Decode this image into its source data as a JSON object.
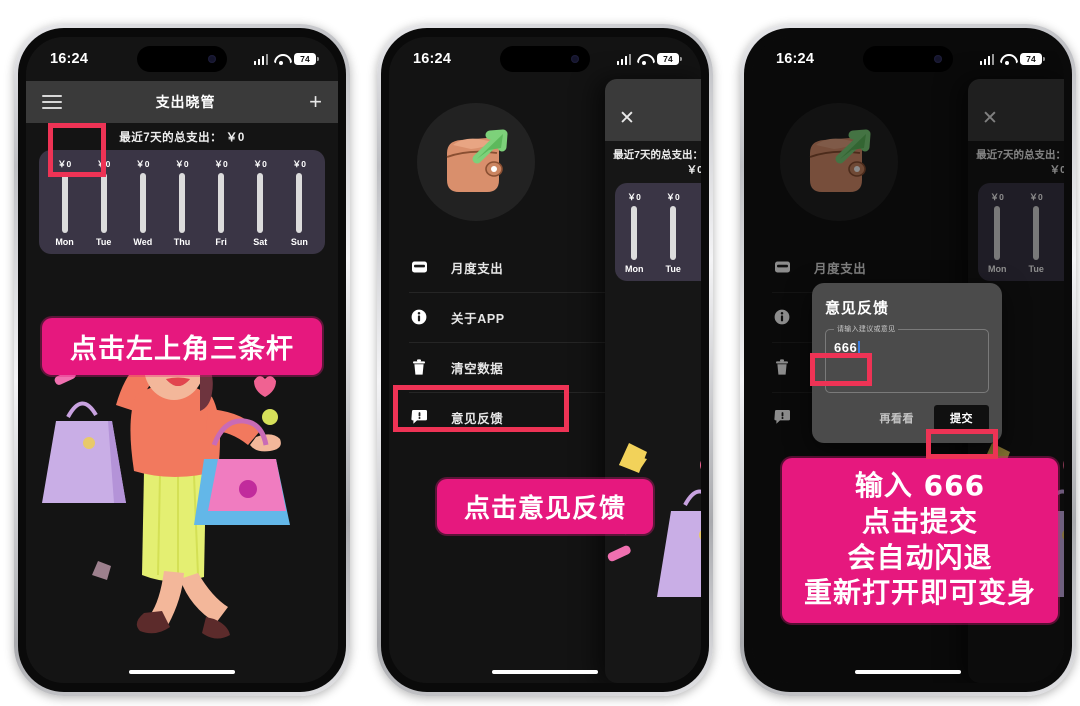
{
  "status_bar": {
    "time": "16:24",
    "battery": "74",
    "signal_icon": "cellular-signal-icon",
    "wifi_icon": "wifi-icon",
    "battery_icon": "battery-icon"
  },
  "app": {
    "nav": {
      "title": "支出晓管",
      "menu_icon": "hamburger-icon",
      "add_icon": "plus-icon"
    },
    "summary": "最近7天的总支出： ￥0",
    "close_icon": "close-icon"
  },
  "chart_data": {
    "type": "bar",
    "title": "最近7天的总支出： ￥0",
    "categories": [
      "Mon",
      "Tue",
      "Wed",
      "Thu",
      "Fri",
      "Sat",
      "Sun"
    ],
    "values": [
      0,
      0,
      0,
      0,
      0,
      0,
      0
    ],
    "value_labels": [
      "￥0",
      "￥0",
      "￥0",
      "￥0",
      "￥0",
      "￥0",
      "￥0"
    ],
    "xlabel": "",
    "ylabel": "",
    "ylim": [
      0,
      0
    ],
    "grid": false,
    "legend": "none",
    "bar_color": "#dcdcdc",
    "card_color": "#3a3545"
  },
  "drawer": {
    "logo_icon": "wallet-arrow-logo-icon",
    "items": [
      {
        "label": "月度支出",
        "icon": "wallet-icon"
      },
      {
        "label": "关于APP",
        "icon": "info-icon"
      },
      {
        "label": "清空数据",
        "icon": "trash-icon"
      },
      {
        "label": "意见反馈",
        "icon": "feedback-bubble-icon"
      }
    ]
  },
  "dialog": {
    "title": "意见反馈",
    "field_label": "请输入建议或意见",
    "field_value": "666",
    "cancel_label": "再看看",
    "submit_label": "提交"
  },
  "banners": {
    "step1": "点击左上角三条杆",
    "step2": "点击意见反馈",
    "step3_lines": [
      "输入 666",
      "点击提交",
      "会自动闪退",
      "重新打开即可变身"
    ]
  },
  "colors": {
    "banner_pink": "#e6187e",
    "highlight_red": "#ee3355",
    "navbar_gray": "#3a3a3a",
    "chart_card": "#3a3545",
    "screen_bg": "#141414"
  }
}
